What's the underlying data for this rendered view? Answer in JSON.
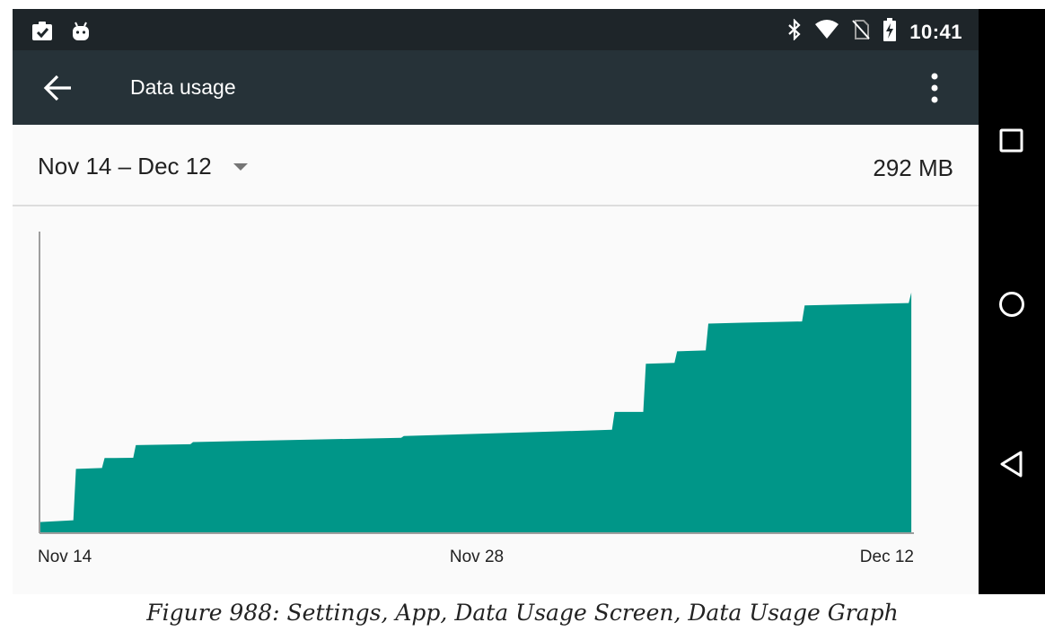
{
  "status_bar": {
    "time": "10:41",
    "left_icons": [
      "clipboard-check-icon",
      "android-icon"
    ],
    "right_icons": [
      "bluetooth-icon",
      "wifi-icon",
      "no-sim-icon",
      "battery-charging-icon"
    ]
  },
  "toolbar": {
    "title": "Data usage",
    "back_icon": "arrow-back-icon",
    "menu_icon": "more-vert-icon",
    "color": "#263238"
  },
  "cycle": {
    "range_label": "Nov 14 – Dec 12",
    "total": "292 MB"
  },
  "chart_data": {
    "type": "area",
    "title": "",
    "xlabel": "",
    "ylabel": "",
    "x_ticks": [
      "Nov 14",
      "Nov 28",
      "Dec 12"
    ],
    "xlim": [
      "Nov 14",
      "Dec 12"
    ],
    "step": true,
    "fill_color": "#009688",
    "points": [
      {
        "x": "Nov 14 00:00",
        "y": 3.7
      },
      {
        "x": "Nov 15 02:00",
        "y": 4.3
      },
      {
        "x": "Nov 15 04:00",
        "y": 21.3
      },
      {
        "x": "Nov 16 00:00",
        "y": 21.6
      },
      {
        "x": "Nov 16 02:00",
        "y": 24.9
      },
      {
        "x": "Nov 17 00:00",
        "y": 25.0
      },
      {
        "x": "Nov 17 02:00",
        "y": 29.2
      },
      {
        "x": "Nov 18 20:00",
        "y": 29.5
      },
      {
        "x": "Nov 18 22:00",
        "y": 30.2
      },
      {
        "x": "Nov 22 00:00",
        "y": 30.9
      },
      {
        "x": "Nov 25 14:00",
        "y": 31.6
      },
      {
        "x": "Nov 25 16:00",
        "y": 32.2
      },
      {
        "x": "Dec 2 08:00",
        "y": 34.3
      },
      {
        "x": "Dec 2 10:00",
        "y": 40.2
      },
      {
        "x": "Dec 3 08:00",
        "y": 40.2
      },
      {
        "x": "Dec 3 10:00",
        "y": 56.2
      },
      {
        "x": "Dec 4 08:00",
        "y": 56.5
      },
      {
        "x": "Dec 4 10:00",
        "y": 60.3
      },
      {
        "x": "Dec 5 08:00",
        "y": 60.6
      },
      {
        "x": "Dec 5 10:00",
        "y": 69.5
      },
      {
        "x": "Dec 6 12:00",
        "y": 69.8
      },
      {
        "x": "Dec 8 10:00",
        "y": 70.2
      },
      {
        "x": "Dec 8 12:00",
        "y": 75.5
      },
      {
        "x": "Dec 11 20:00",
        "y": 76.3
      },
      {
        "x": "Dec 11 22:00",
        "y": 79.8
      }
    ],
    "grid": false,
    "legend": "none"
  },
  "caption": "Figure 988: Settings, App, Data Usage Screen, Data Usage Graph",
  "nav_bar": {
    "buttons": [
      "recents-icon",
      "home-icon",
      "back-icon"
    ]
  }
}
